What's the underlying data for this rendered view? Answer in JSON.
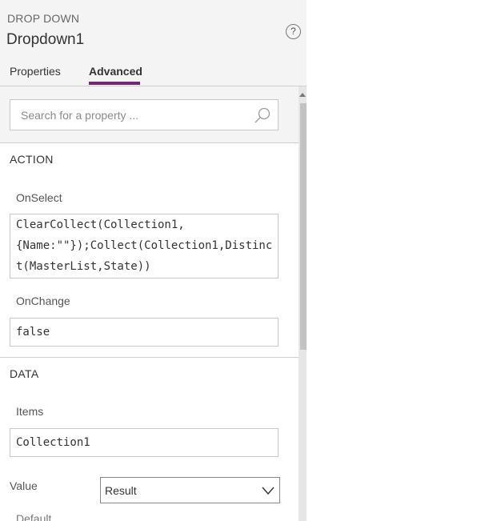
{
  "header": {
    "control_type": "DROP DOWN",
    "control_name": "Dropdown1",
    "help_icon": "question-circle-icon",
    "help_glyph": "?"
  },
  "tabs": [
    {
      "label": "Properties",
      "selected": false
    },
    {
      "label": "Advanced",
      "selected": true
    }
  ],
  "accent_color": "#742774",
  "search": {
    "placeholder": "Search for a property ...",
    "value": "",
    "icon": "search-icon"
  },
  "sections": {
    "action": {
      "title": "ACTION",
      "onselect_label": "OnSelect",
      "onselect_value": "ClearCollect(Collection1,\n{Name:\"\"});Collect(Collection1,Distinct(MasterList,State))",
      "onchange_label": "OnChange",
      "onchange_value": "false"
    },
    "data": {
      "title": "DATA",
      "items_label": "Items",
      "items_value": "Collection1",
      "value_label": "Value",
      "value_selected": "Result",
      "value_icon": "chevron-down-icon",
      "default_label_partial": "Default"
    }
  }
}
